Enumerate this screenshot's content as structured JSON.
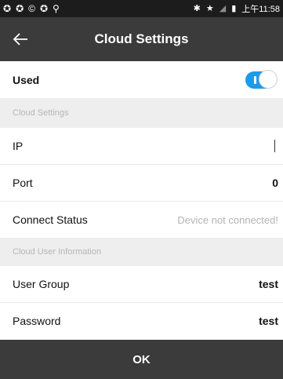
{
  "status_bar": {
    "left_icons": [
      "circle-arrows-icon",
      "circle-arrows-icon",
      "circle-c-icon",
      "circle-arrows-icon",
      "location-pin-icon"
    ],
    "right_icons": [
      "bluetooth-icon",
      "star-icon",
      "signal-icon",
      "battery-icon"
    ],
    "time": "上午11:58"
  },
  "app_bar": {
    "title": "Cloud Settings"
  },
  "used": {
    "label": "Used",
    "enabled": true
  },
  "cloud_settings": {
    "header": "Cloud Settings",
    "ip": {
      "label": "IP",
      "value": ""
    },
    "port": {
      "label": "Port",
      "value": "0"
    },
    "connect_status": {
      "label": "Connect Status",
      "value": "Device not connected!"
    }
  },
  "cloud_user": {
    "header": "Cloud User Information",
    "user_group": {
      "label": "User Group",
      "value": "test"
    },
    "password": {
      "label": "Password",
      "value": "test"
    }
  },
  "ok_button": {
    "label": "OK"
  },
  "colors": {
    "app_bar": "#3b3b3b",
    "toggle_on": "#1e9be8",
    "section_bg": "#eeeeee"
  }
}
